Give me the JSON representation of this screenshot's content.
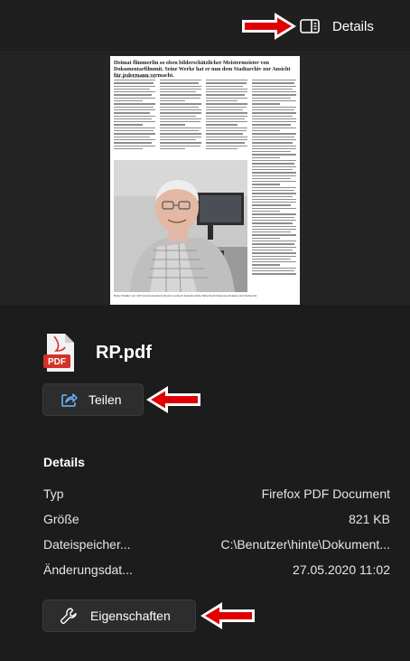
{
  "header": {
    "details_label": "Details"
  },
  "preview": {
    "headline": "Heimat flimmerlin so oben bilderschätzlicher Meistermeister von Dokumentarfilmmit. Seine Werke hat er nun dem Stadtarchiv zur Ansicht für jedermann vermacht.",
    "byline": "VON HILDA OM DUM HULDA",
    "caption": "Heinz Winkler wie 1995 klein Kalender hobbyaler Grebtech Kemehra filme filme Dorm Klassenar-Neuberg und Stadtarchiv"
  },
  "file": {
    "name": "RP.pdf",
    "icon_text": "PDF"
  },
  "actions": {
    "share_label": "Teilen",
    "properties_label": "Eigenschaften"
  },
  "details": {
    "title": "Details",
    "rows": [
      {
        "key": "Typ",
        "value": "Firefox PDF Document"
      },
      {
        "key": "Größe",
        "value": "821 KB"
      },
      {
        "key": "Dateispeicher...",
        "value": "C:\\Benutzer\\hinte\\Dokument..."
      },
      {
        "key": "Änderungsdat...",
        "value": "27.05.2020 11:02"
      }
    ]
  },
  "colors": {
    "background": "#1a1a1a",
    "button": "#2d2d2d",
    "arrow_red": "#e00000",
    "pdf_red": "#d1322a"
  },
  "icons": [
    "details-pane-icon",
    "pdf-file-icon",
    "share-icon",
    "wrench-icon",
    "red-arrow-icon"
  ]
}
